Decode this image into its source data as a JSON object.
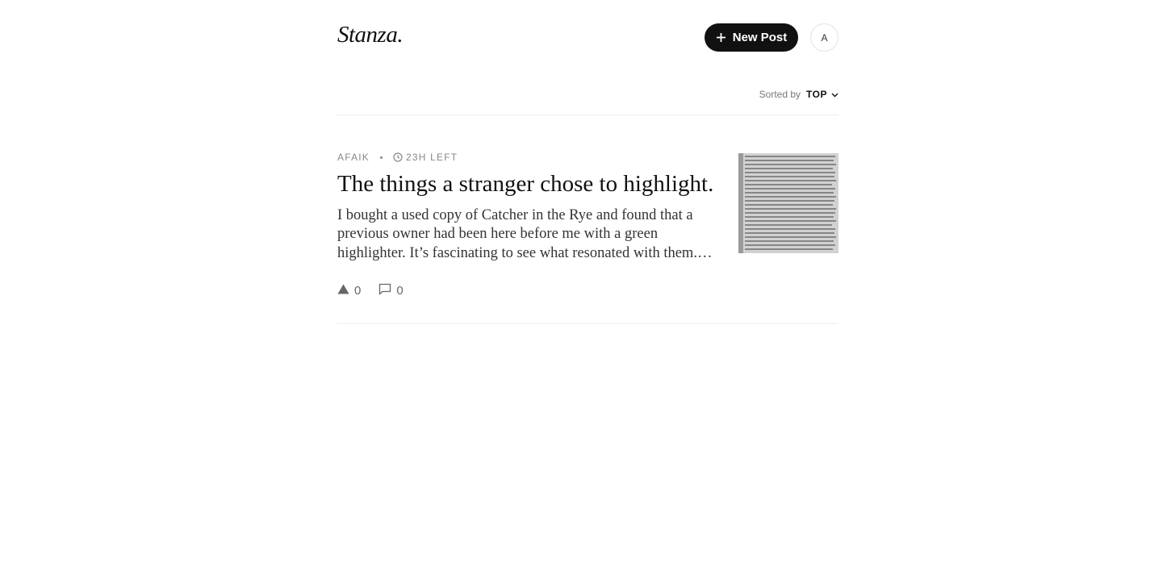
{
  "header": {
    "logo": "Stanza.",
    "new_post_label": "New Post",
    "avatar_initial": "A"
  },
  "sort": {
    "label": "Sorted by",
    "value": "TOP"
  },
  "post": {
    "tag": "AFAIK",
    "time_left": "23H LEFT",
    "title": "The things a stranger chose to highlight.",
    "excerpt": "I bought a used copy of Catcher in the Rye and found that a previous owner had been here before me with a green highlighter. It’s fascinating to see what resonated with them.…",
    "votes": "0",
    "comments": "0"
  },
  "icons": {
    "plus": "plus-icon",
    "chevron": "chevron-down-icon",
    "clock": "clock-icon",
    "vote": "triangle-vote-icon",
    "comment": "comment-icon"
  }
}
